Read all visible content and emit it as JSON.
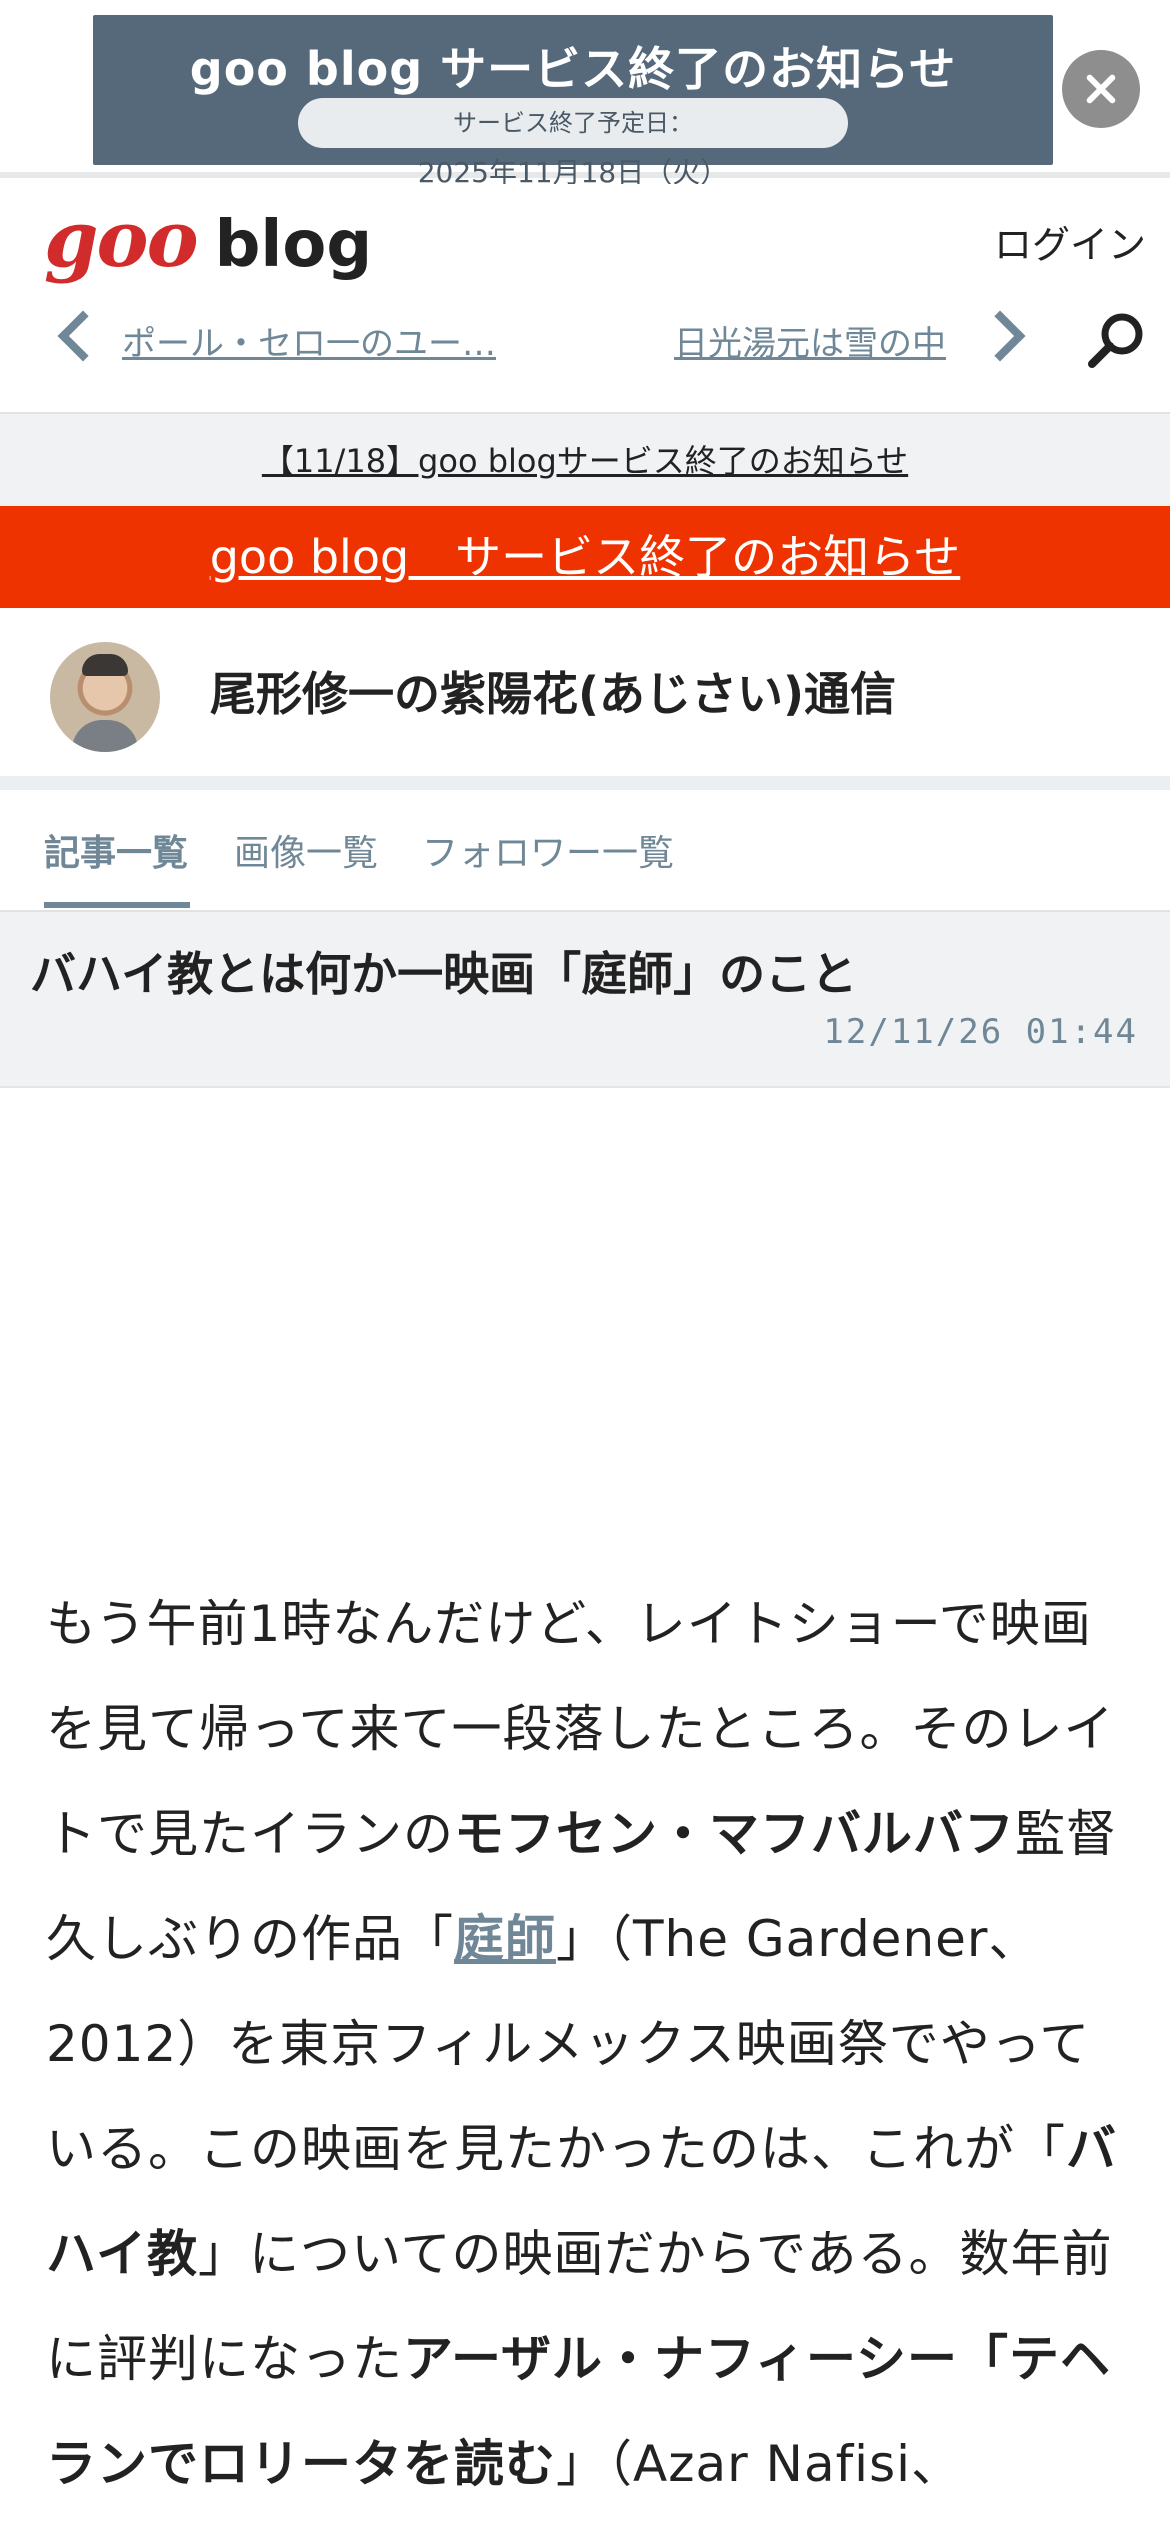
{
  "banner": {
    "title": "goo blog サービス終了のお知らせ",
    "pill_label": "サービス終了予定日：",
    "pill_date": "2025年11月18日（火）",
    "close_icon": "close-icon"
  },
  "header": {
    "logo_goo": "goo",
    "logo_blog": "blog",
    "login": "ログイン",
    "prev_article": "ポール・セロ一のユー…",
    "next_article": "日光湯元は雪の中",
    "search_icon": "search-icon"
  },
  "notice": {
    "text": "【11/18】goo blogサービス終了のお知らせ"
  },
  "red_banner": {
    "text": "goo blog　サービス終了のお知らせ",
    "color": "#ee3300"
  },
  "blog": {
    "title": "尾形修一の紫陽花(あじさい)通信"
  },
  "tabs": [
    {
      "label": "記事一覧"
    },
    {
      "label": "画像一覧"
    },
    {
      "label": "フォロワー一覧"
    }
  ],
  "article": {
    "title": "バハイ教とは何か一映画「庭師」のこと",
    "date": "12/11/26 01:44",
    "body": {
      "p1": "もう午前1時なんだけど、レイトショーで映画を見て帰って来て一段落したところ。そのレイトで見たイランの",
      "b1": "モフセン・マフバルバフ",
      "p2": "監督久しぶりの作品「",
      "link1": "庭師",
      "p3": "」（The Gardener、2012）を東京フィルメックス映画祭でやっている。この映画を見たかったのは、これが「",
      "b2": "バハイ教",
      "p4": "」についての映画だからである。数年前に評判になった",
      "b3": "アーザル・ナフィーシー「テヘランでロリータを読む",
      "p5": "」（Azar Nafisi、"
    }
  },
  "colors": {
    "accent": "#6f8796",
    "banner_bg": "#55697a"
  }
}
